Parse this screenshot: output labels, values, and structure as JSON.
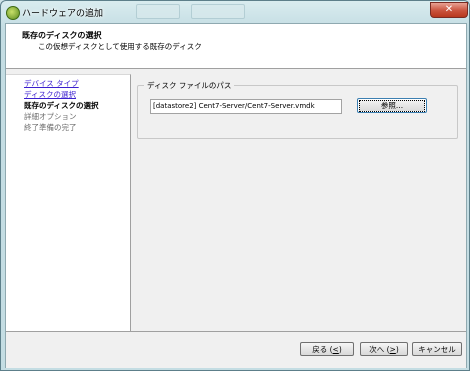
{
  "window": {
    "title": "ハードウェアの追加",
    "close_symbol": "✕"
  },
  "header": {
    "title": "既存のディスクの選択",
    "subtitle": "この仮想ディスクとして使用する既存のディスク"
  },
  "steps": [
    {
      "label": "デバイス タイプ",
      "state": "link"
    },
    {
      "label": "ディスクの選択",
      "state": "link"
    },
    {
      "label": "既存のディスクの選択",
      "state": "current"
    },
    {
      "label": "詳細オプション",
      "state": "future"
    },
    {
      "label": "終了準備の完了",
      "state": "future"
    }
  ],
  "disk_path": {
    "group_label": "ディスク ファイルのパス",
    "value": "[datastore2] Cent7-Server/Cent7-Server.vmdk",
    "browse_label": "参照..."
  },
  "footer": {
    "back_label": "戻る (",
    "back_key": "<",
    "next_label": "次へ (",
    "next_key": ">",
    "paren_close": ")",
    "cancel_label": "キャンセル"
  },
  "colors": {
    "link": "#3b1fcf",
    "titlebar": "#c4dde3",
    "close": "#c9523c"
  }
}
